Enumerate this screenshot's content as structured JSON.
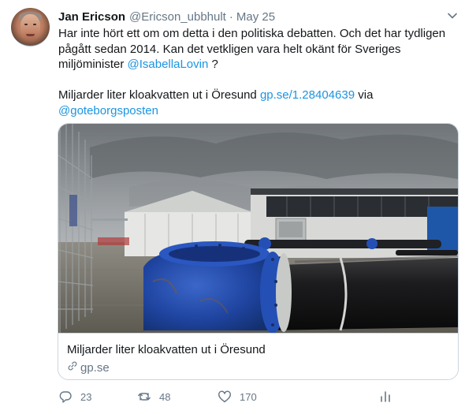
{
  "tweet": {
    "author_name": "Jan Ericson",
    "handle": "@Ericson_ubbhult",
    "separator": "·",
    "date": "May 25",
    "line1": "Har inte hört ett om om detta i den politiska debatten. Och det har tydligen",
    "line2": "pågått sedan 2014. Kan det vetkligen vara helt okänt för Sveriges",
    "line3_text": "miljöminister ",
    "mention": "@IsabellaLovin",
    "line3_end": " ?",
    "line4_text": "Miljarder liter kloakvatten ut i Öresund ",
    "url_text": "gp.se/1.28404639",
    "via_text": " via",
    "via_mention": "@goteborgsposten"
  },
  "card": {
    "title": "Miljarder liter kloakvatten ut i Öresund",
    "domain": "gp.se"
  },
  "actions": {
    "reply_count": "23",
    "retweet_count": "48",
    "like_count": "170"
  },
  "colors": {
    "link": "#1b95e0",
    "muted": "#657786",
    "text": "#14171a",
    "border": "#ccd6dd"
  },
  "icons": [
    "caret-down-icon",
    "link-icon",
    "reply-icon",
    "retweet-icon",
    "like-icon",
    "analytics-icon"
  ]
}
